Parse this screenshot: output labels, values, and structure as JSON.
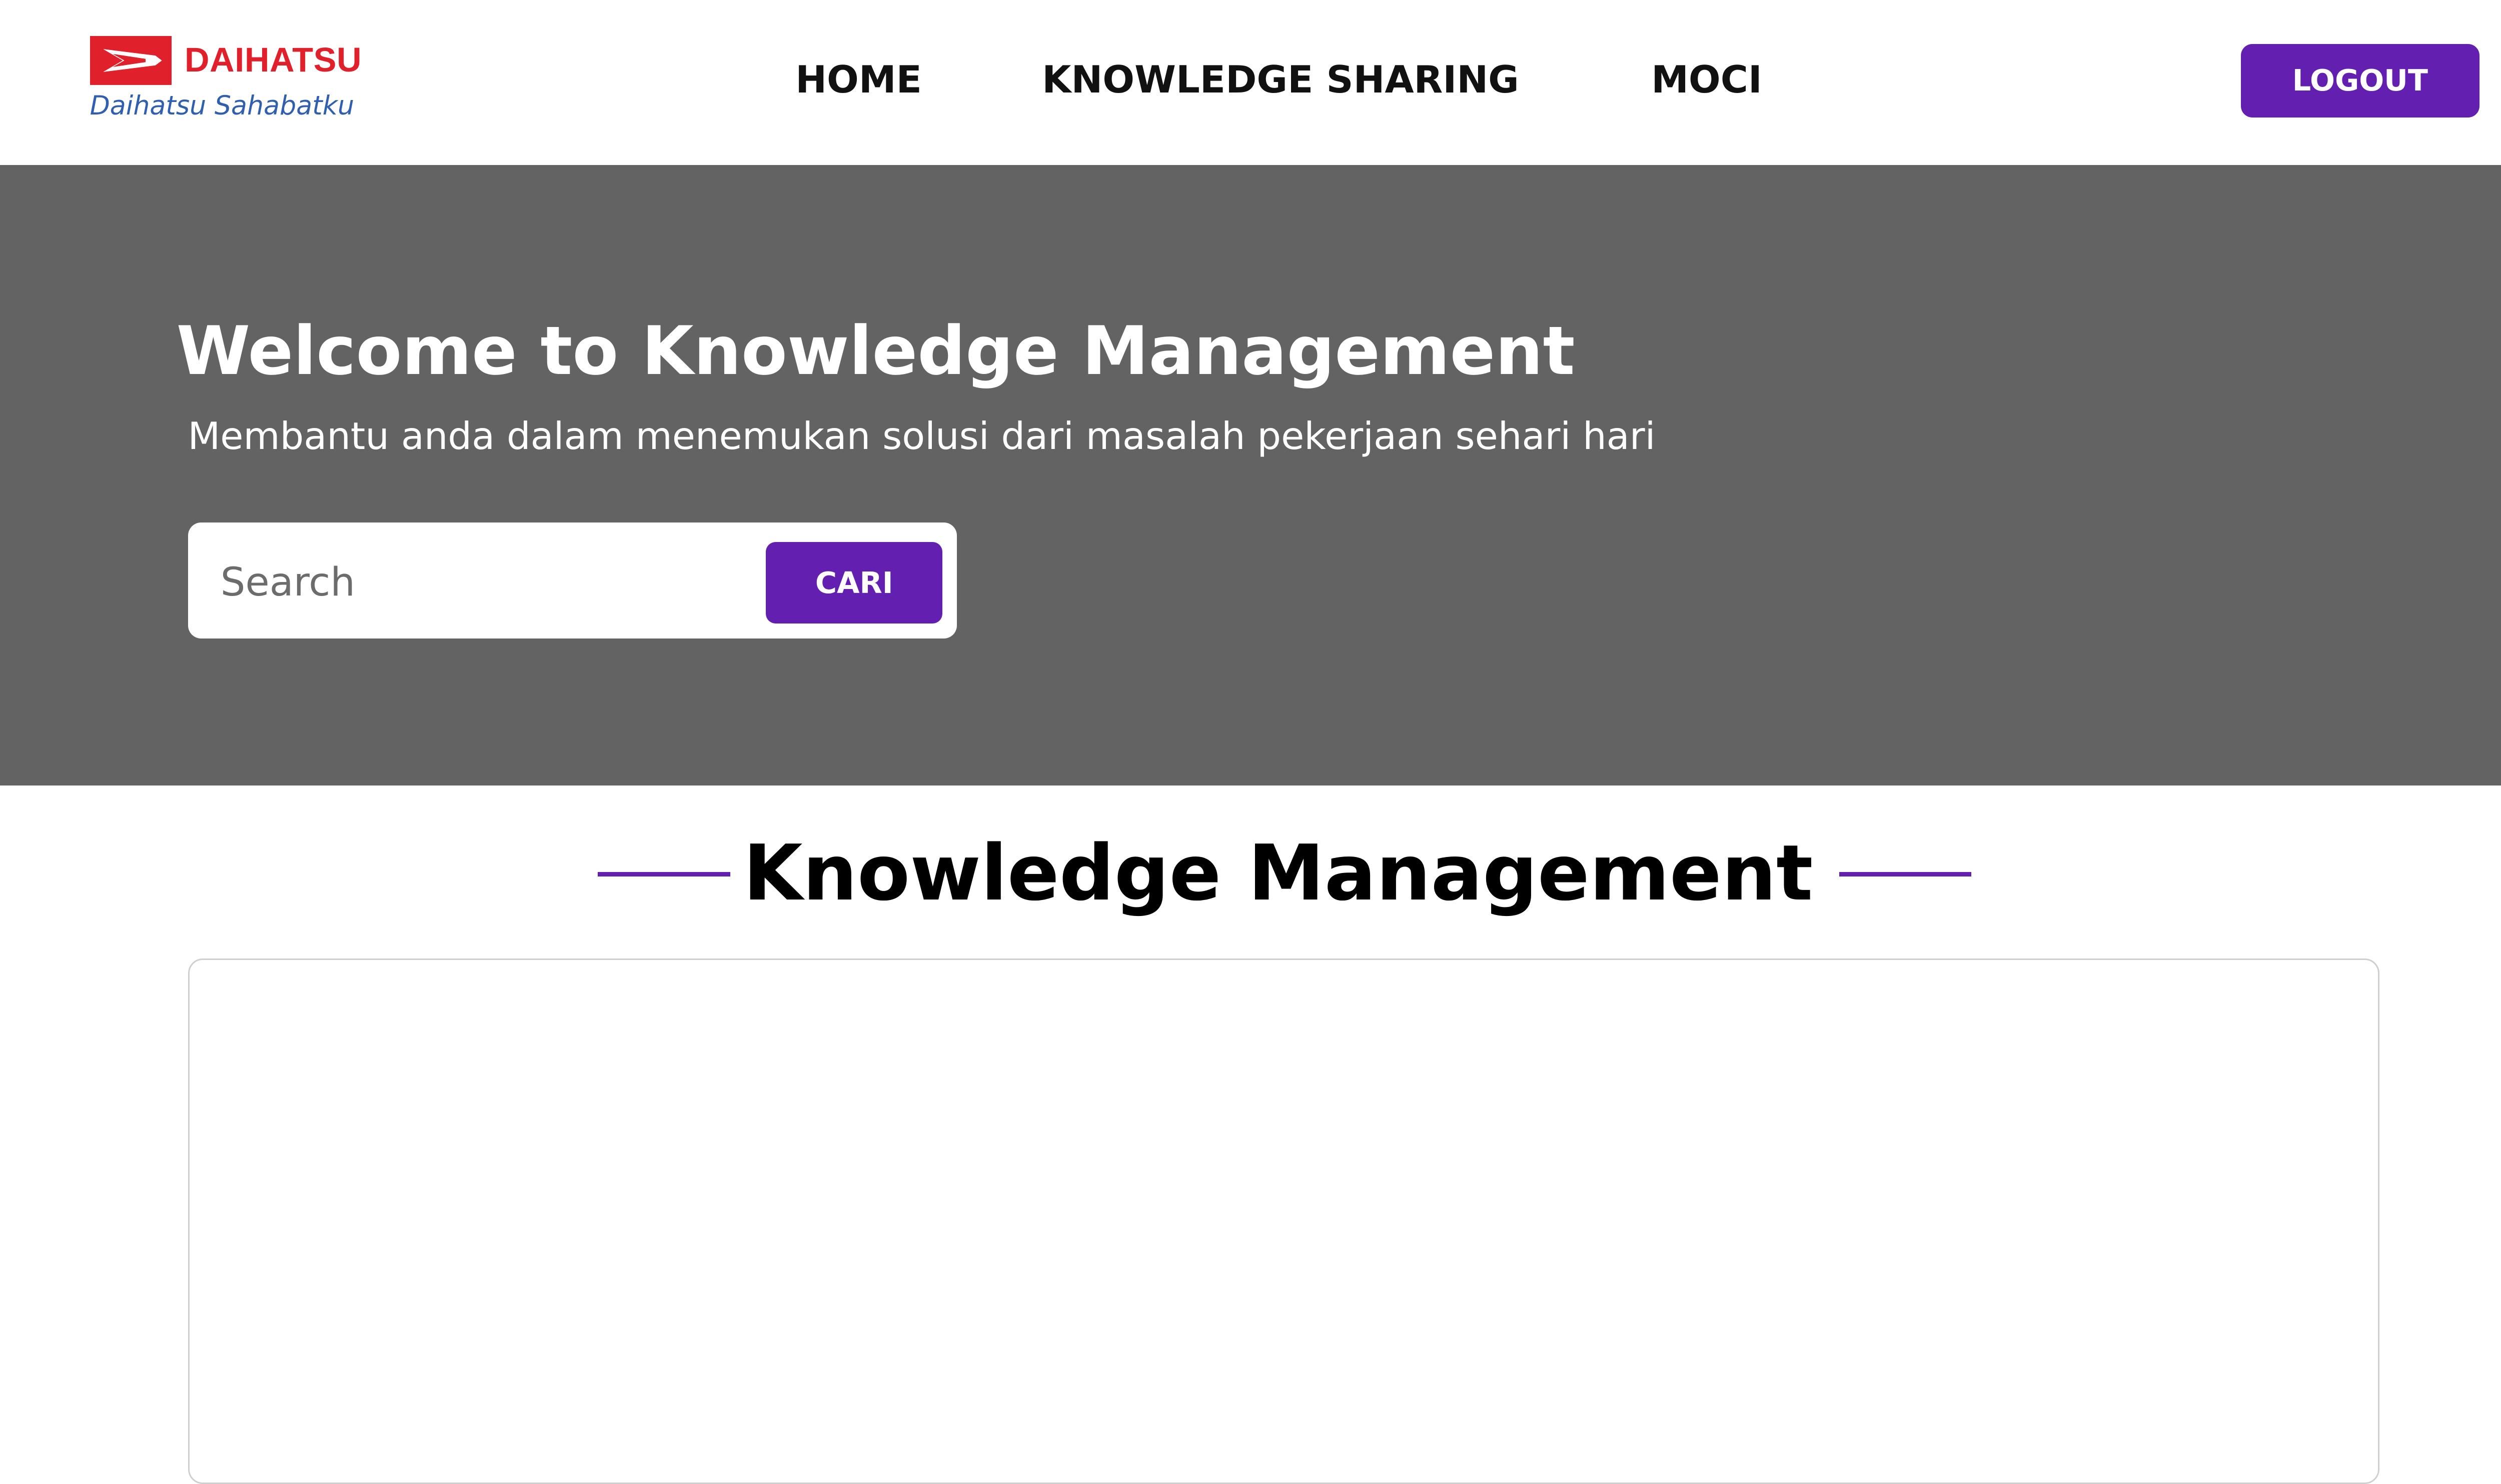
{
  "header": {
    "logo": {
      "brand": "DAIHATSU",
      "tagline": "Daihatsu Sahabatku",
      "icon": "daihatsu-emblem-icon"
    },
    "nav": [
      {
        "label": "HOME"
      },
      {
        "label": "KNOWLEDGE SHARING"
      },
      {
        "label": "MOCI"
      }
    ],
    "logout_label": "LOGOUT"
  },
  "hero": {
    "title": "Welcome to Knowledge Management",
    "subtitle": "Membantu anda dalam menemukan solusi dari masalah pekerjaan sehari hari",
    "search": {
      "placeholder": "Search",
      "value": "",
      "button_label": "CARI"
    }
  },
  "section": {
    "title": "Knowledge Management"
  },
  "colors": {
    "accent": "#6320b0",
    "hero_background": "#636363",
    "brand_red": "#e0202a",
    "tagline_blue": "#2f5fae"
  }
}
